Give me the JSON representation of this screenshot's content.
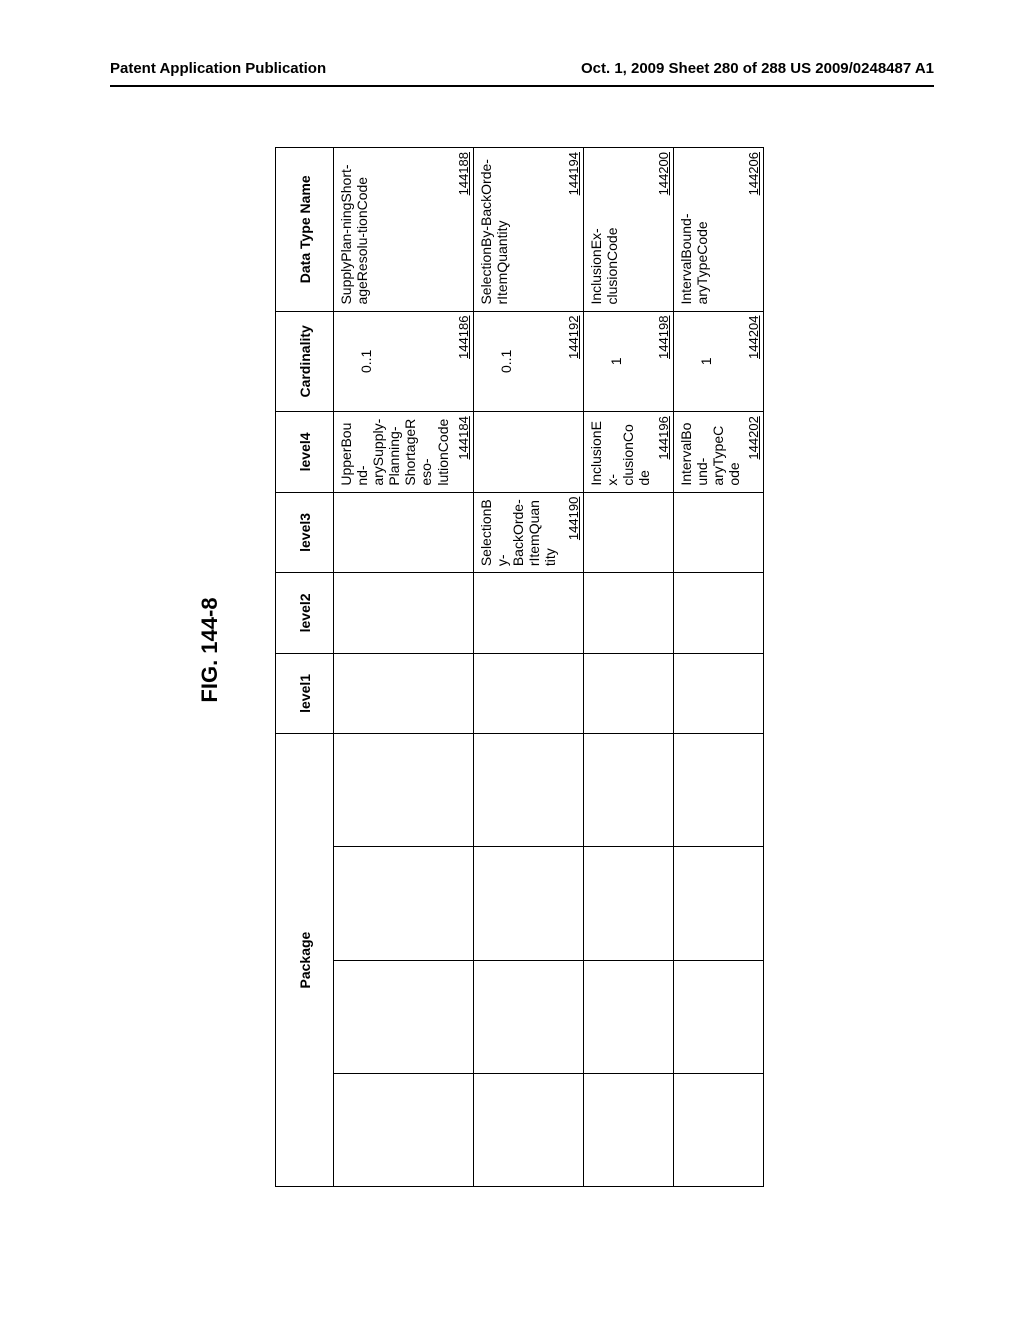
{
  "header": {
    "left": "Patent Application Publication",
    "right": "Oct. 1, 2009  Sheet 280 of 288   US 2009/0248487 A1"
  },
  "figure_title": "FIG. 144-8",
  "columns": {
    "package": "Package",
    "level1": "level1",
    "level2": "level2",
    "level3": "level3",
    "level4": "level4",
    "cardinality": "Cardinality",
    "data_type_name": "Data Type Name"
  },
  "rows": [
    {
      "level3": "",
      "level3_ref": "",
      "level4": "UpperBound-arySupply-Planning-ShortageReso-lutionCode",
      "level4_ref": "144184",
      "cardinality": "0..1",
      "cardinality_ref": "144186",
      "data_type_name": "SupplyPlan-ningShort-ageResolu-tionCode",
      "data_type_name_ref": "144188"
    },
    {
      "level3": "SelectionBy-BackOrde-rItemQuantity",
      "level3_ref": "144190",
      "level4": "",
      "level4_ref": "",
      "cardinality": "0..1",
      "cardinality_ref": "144192",
      "data_type_name": "SelectionBy-BackOrde-rItemQuantity",
      "data_type_name_ref": "144194"
    },
    {
      "level3": "",
      "level3_ref": "",
      "level4": "InclusionEx-clusionCode",
      "level4_ref": "144196",
      "cardinality": "1",
      "cardinality_ref": "144198",
      "data_type_name": "InclusionEx-clusionCode",
      "data_type_name_ref": "144200"
    },
    {
      "level3": "",
      "level3_ref": "",
      "level4": "IntervalBound-aryTypeCode",
      "level4_ref": "144202",
      "cardinality": "1",
      "cardinality_ref": "144204",
      "data_type_name": "IntervalBound-aryTypeCode",
      "data_type_name_ref": "144206"
    }
  ]
}
